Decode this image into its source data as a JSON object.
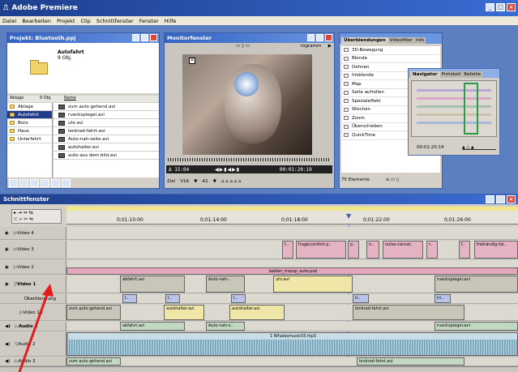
{
  "app": {
    "title": "Adobe Premiere"
  },
  "menu": [
    "Datei",
    "Bearbeiten",
    "Projekt",
    "Clip",
    "Schnittfenster",
    "Fenster",
    "Hilfe"
  ],
  "project": {
    "title": "Projekt: Bluetooth.ppj",
    "bin_name": "Autofahrt",
    "bin_count": "9 Obj.",
    "col_ablage": "Ablage",
    "col_count": "9 Obj.",
    "col_name": "Name",
    "folders": [
      "Ablage",
      "Autofahrt",
      "Büro",
      "Haus",
      "Unterfahrt"
    ],
    "files": [
      "zum auto gehend.avi",
      "rueckspiegel.avi",
      "uhr.avi",
      "lenkrad-fahrt.avi",
      "Auto-nah-seite.avi",
      "autohalter.avi",
      "auto-aus dem bild.avi"
    ]
  },
  "monitor": {
    "title": "Monitorfenster",
    "tab_programm": "rogramm",
    "timecode_left": "Δ 15:04",
    "timecode_right": "00:01:20:19",
    "ziel_label": "Ziel",
    "ziel_v": "V1A",
    "ziel_a": "A1"
  },
  "effects": {
    "tab1": "Überblendungen",
    "tab2": "Videofilter",
    "tab3": "Info",
    "items": [
      "3D-Bewegung",
      "Blende",
      "Dehnen",
      "Irisblende",
      "Map",
      "Seite aufrollen",
      "Spezialeffekt",
      "Wischen",
      "Zoom",
      "Überschieben",
      "QuickTime"
    ],
    "footer": "75 Elemente"
  },
  "navigator": {
    "tab1": "Navigator",
    "tab2": "Protokoll",
    "tab3": "Befehle",
    "timecode": "00:01:20:14"
  },
  "timeline": {
    "title": "Schnittfenster",
    "ruler": [
      "0;01:10:00",
      "0;01:14:00",
      "0;01:18:00",
      "0;01:22:00",
      "0;01:26:00"
    ],
    "tracks": {
      "v4": "Video 4",
      "v3": "Video 3",
      "v2": "Video 2",
      "v1": "Video 1",
      "ueb": "Überblendung",
      "v1b": "Video 1B",
      "a1": "Audio 1",
      "a2": "Audio 2",
      "a3": "Audio 3"
    },
    "v3_clips": [
      "t..",
      "fragecomfort.p..",
      "p..",
      "n..",
      "noise-cancel..",
      "r..",
      "f..",
      "freihändig-fal.."
    ],
    "v2_clip": "balken_trazop_auto.psd",
    "v1_clips": [
      "abfahrt.avi",
      "Auto-nah-..",
      "uhr.avi",
      "rueckspiegel.avi"
    ],
    "ueb_labels": [
      "I..",
      "I..",
      "I..",
      "Ir..",
      "Iri.."
    ],
    "v1b_clips": [
      "zum auto gehend.avi",
      "autohalter.avi",
      "autohalter.avi",
      "lenkrad-fahrt.avi"
    ],
    "a1_clips": [
      "abfahrt.avi",
      "Auto-nah-s..",
      "rueckspiegel.avi"
    ],
    "a2_clip": "1 Whalesmusic03.mp3",
    "a3_clips": [
      "zum auto gehend.avi",
      "lenkrad-fahrt.avi"
    ]
  }
}
